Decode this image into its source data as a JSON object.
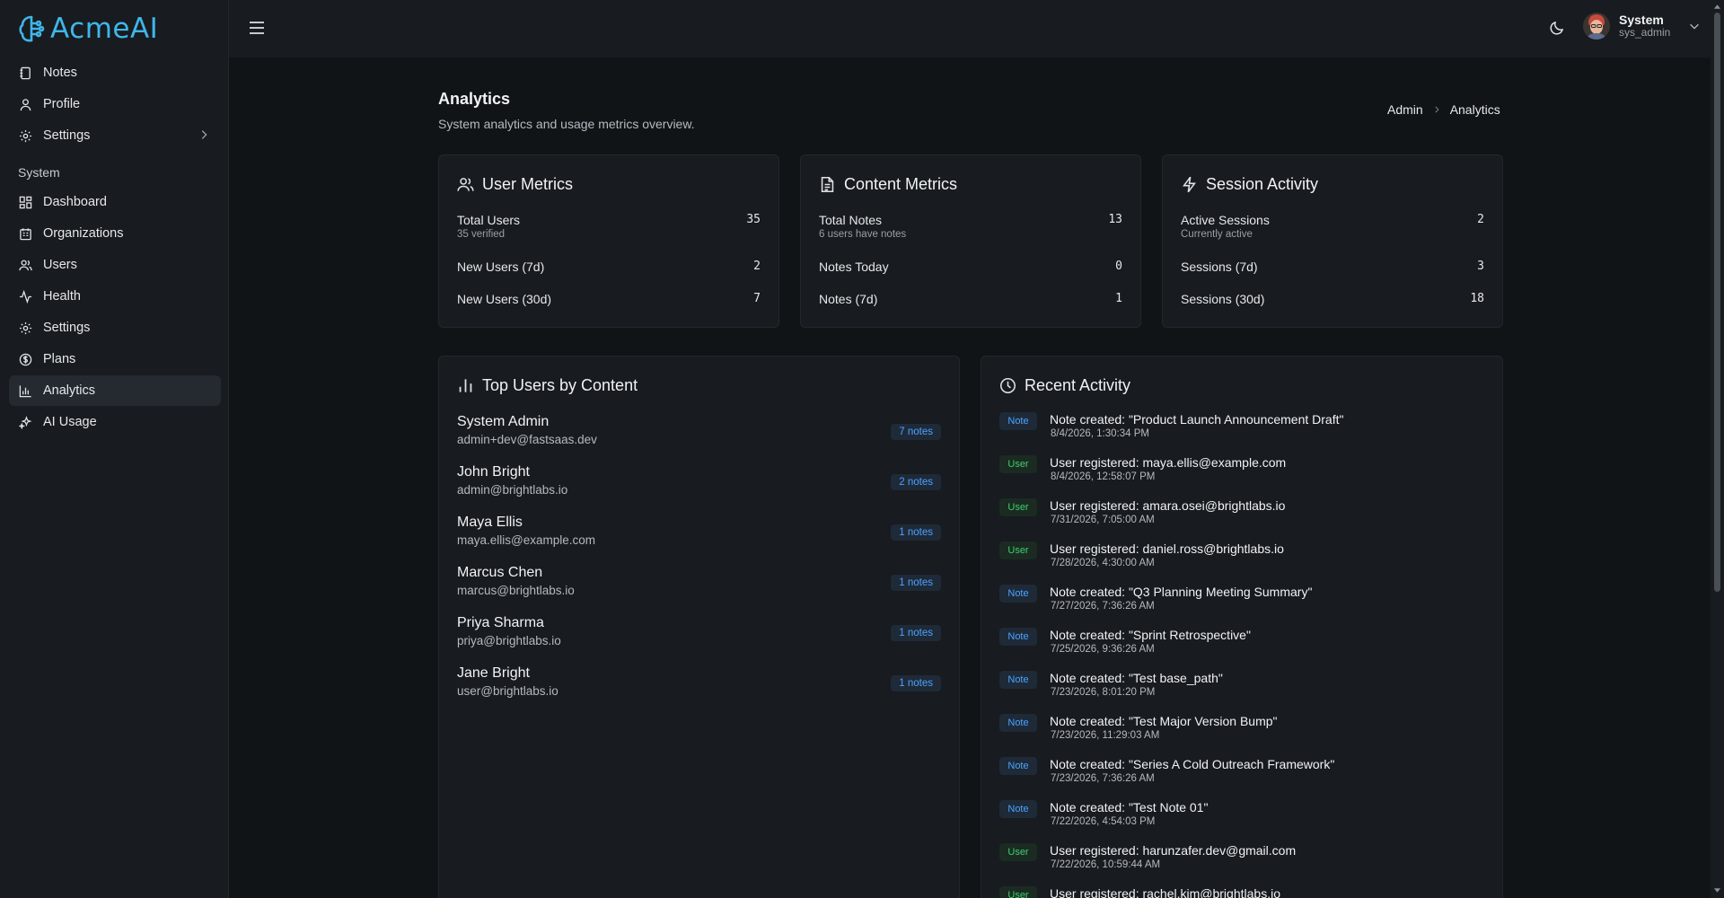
{
  "brand": {
    "name": "AcmeAI",
    "accent": "#3fb6e8"
  },
  "sidebar": {
    "items": [
      {
        "label": "Notes",
        "icon": "notebook-icon"
      },
      {
        "label": "Profile",
        "icon": "user-icon"
      },
      {
        "label": "Settings",
        "icon": "gear-icon"
      }
    ],
    "section_label": "System",
    "system_items": [
      {
        "label": "Dashboard",
        "icon": "dashboard-icon"
      },
      {
        "label": "Organizations",
        "icon": "building-icon"
      },
      {
        "label": "Users",
        "icon": "users-icon"
      },
      {
        "label": "Health",
        "icon": "activity-icon"
      },
      {
        "label": "Settings",
        "icon": "gear-icon"
      },
      {
        "label": "Plans",
        "icon": "dollar-circle-icon"
      },
      {
        "label": "Analytics",
        "icon": "bar-chart-icon",
        "active": true
      },
      {
        "label": "AI Usage",
        "icon": "sparkles-icon"
      }
    ]
  },
  "header": {
    "user_name": "System",
    "user_handle": "sys_admin"
  },
  "page": {
    "title": "Analytics",
    "subtitle": "System analytics and usage metrics overview.",
    "breadcrumb": [
      "Admin",
      "Analytics"
    ]
  },
  "user_metrics": {
    "title": "User Metrics",
    "rows": [
      {
        "label": "Total Users",
        "sub": "35 verified",
        "value": "35"
      },
      {
        "label": "New Users (7d)",
        "value": "2"
      },
      {
        "label": "New Users (30d)",
        "value": "7"
      }
    ]
  },
  "content_metrics": {
    "title": "Content Metrics",
    "rows": [
      {
        "label": "Total Notes",
        "sub": "6 users have notes",
        "value": "13"
      },
      {
        "label": "Notes Today",
        "value": "0"
      },
      {
        "label": "Notes (7d)",
        "value": "1"
      }
    ]
  },
  "session_activity": {
    "title": "Session Activity",
    "rows": [
      {
        "label": "Active Sessions",
        "sub": "Currently active",
        "value": "2"
      },
      {
        "label": "Sessions (7d)",
        "value": "3"
      },
      {
        "label": "Sessions (30d)",
        "value": "18"
      }
    ]
  },
  "top_users": {
    "title": "Top Users by Content",
    "users": [
      {
        "name": "System Admin",
        "email": "admin+dev@fastsaas.dev",
        "notes": "7 notes"
      },
      {
        "name": "John Bright",
        "email": "admin@brightlabs.io",
        "notes": "2 notes"
      },
      {
        "name": "Maya Ellis",
        "email": "maya.ellis@example.com",
        "notes": "1 notes"
      },
      {
        "name": "Marcus Chen",
        "email": "marcus@brightlabs.io",
        "notes": "1 notes"
      },
      {
        "name": "Priya Sharma",
        "email": "priya@brightlabs.io",
        "notes": "1 notes"
      },
      {
        "name": "Jane Bright",
        "email": "user@brightlabs.io",
        "notes": "1 notes"
      }
    ]
  },
  "recent_activity": {
    "title": "Recent Activity",
    "items": [
      {
        "type": "Note",
        "text": "Note created: \"Product Launch Announcement Draft\"",
        "time": "8/4/2026, 1:30:34 PM"
      },
      {
        "type": "User",
        "text": "User registered: maya.ellis@example.com",
        "time": "8/4/2026, 12:58:07 PM"
      },
      {
        "type": "User",
        "text": "User registered: amara.osei@brightlabs.io",
        "time": "7/31/2026, 7:05:00 AM"
      },
      {
        "type": "User",
        "text": "User registered: daniel.ross@brightlabs.io",
        "time": "7/28/2026, 4:30:00 AM"
      },
      {
        "type": "Note",
        "text": "Note created: \"Q3 Planning Meeting Summary\"",
        "time": "7/27/2026, 7:36:26 AM"
      },
      {
        "type": "Note",
        "text": "Note created: \"Sprint Retrospective\"",
        "time": "7/25/2026, 9:36:26 AM"
      },
      {
        "type": "Note",
        "text": "Note created: \"Test base_path\"",
        "time": "7/23/2026, 8:01:20 PM"
      },
      {
        "type": "Note",
        "text": "Note created: \"Test Major Version Bump\"",
        "time": "7/23/2026, 11:29:03 AM"
      },
      {
        "type": "Note",
        "text": "Note created: \"Series A Cold Outreach Framework\"",
        "time": "7/23/2026, 7:36:26 AM"
      },
      {
        "type": "Note",
        "text": "Note created: \"Test Note 01\"",
        "time": "7/22/2026, 4:54:03 PM"
      },
      {
        "type": "User",
        "text": "User registered: harunzafer.dev@gmail.com",
        "time": "7/22/2026, 10:59:44 AM"
      },
      {
        "type": "User",
        "text": "User registered: rachel.kim@brightlabs.io",
        "time": ""
      }
    ]
  },
  "colors": {
    "note_badge": "#4aa3ff",
    "user_badge": "#3ecf6e",
    "background": "#111417",
    "surface": "#181b1f"
  }
}
